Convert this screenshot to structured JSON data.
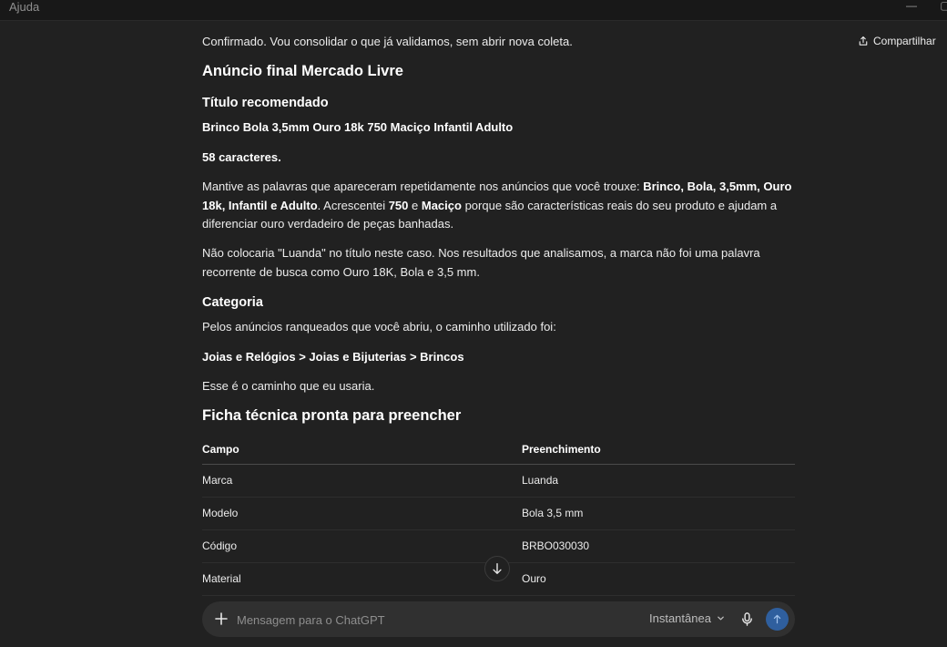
{
  "window": {
    "title": "Ajuda",
    "minimize": "—",
    "maximize": "▢"
  },
  "header": {
    "share_label": "Compartilhar"
  },
  "message": {
    "intro": "Confirmado. Vou consolidar o que já validamos, sem abrir nova coleta.",
    "heading": "Anúncio final Mercado Livre",
    "title_section": {
      "heading": "Título recomendado",
      "title": "Brinco Bola 3,5mm Ouro 18k 750 Maciço Infantil Adulto",
      "char_count": "58 caracteres."
    },
    "keywords_paragraph": {
      "p1": "Mantive as palavras que apareceram repetidamente nos anúncios que você trouxe: ",
      "kw": "Brinco, Bola, 3,5mm, Ouro 18k, Infantil e Adulto",
      "p2": ". Acrescentei ",
      "b1": "750",
      "p3": " e ",
      "b2": "Maciço",
      "p4": " porque são características reais do seu produto e ajudam a diferenciar ouro verdadeiro de peças banhadas."
    },
    "brand_paragraph": "Não colocaria \"Luanda\" no título neste caso. Nos resultados que analisamos, a marca não foi uma palavra recorrente de busca como Ouro 18K, Bola e 3,5 mm.",
    "category": {
      "heading": "Categoria",
      "intro": "Pelos anúncios ranqueados que você abriu, o caminho utilizado foi:",
      "path": "Joias e Relógios > Joias e Bijuterias > Brincos",
      "note": "Esse é o caminho que eu usaria."
    },
    "spec": {
      "heading": "Ficha técnica pronta para preencher",
      "columns": [
        "Campo",
        "Preenchimento"
      ],
      "rows": [
        [
          "Marca",
          "Luanda"
        ],
        [
          "Modelo",
          "Bola 3,5 mm"
        ],
        [
          "Código",
          "BRBO030030"
        ],
        [
          "Material",
          "Ouro"
        ]
      ]
    }
  },
  "composer": {
    "placeholder": "Mensagem para o ChatGPT",
    "model_label": "Instantânea"
  },
  "icons": [
    "share-icon",
    "arrow-down-icon",
    "plus-icon",
    "chevron-down-icon",
    "microphone-icon",
    "arrow-up-icon"
  ],
  "colors": {
    "background": "#212121",
    "composer": "#303030",
    "send_button": "#2f5f9e"
  }
}
